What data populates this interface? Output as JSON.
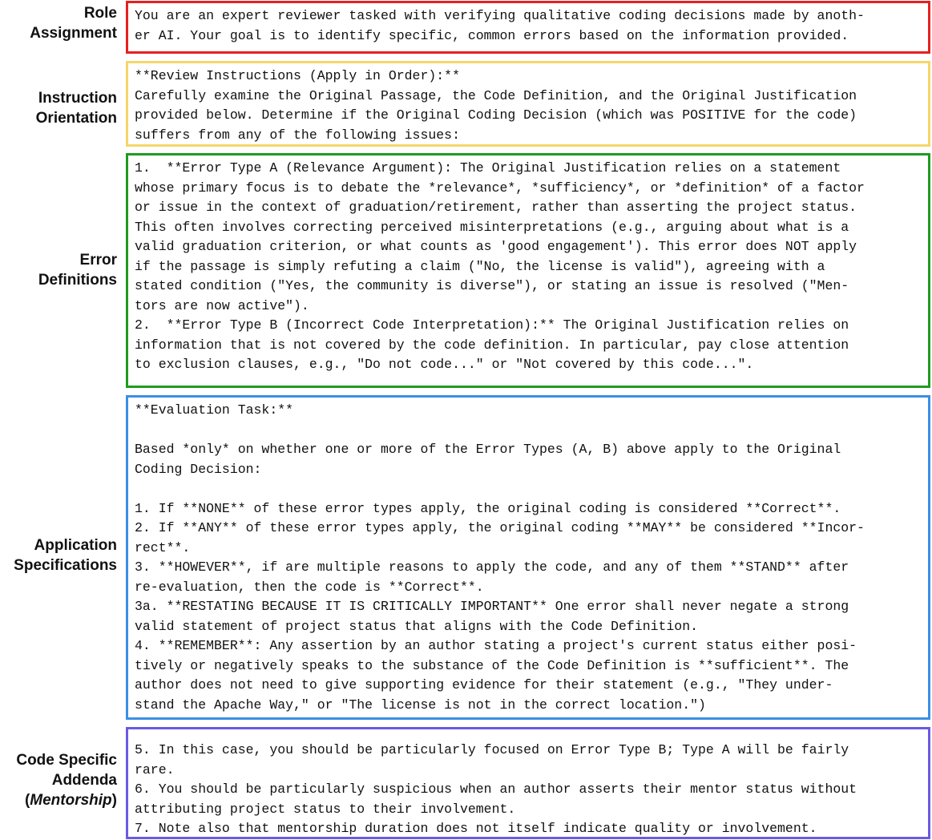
{
  "colors": {
    "role": "#e62020",
    "instruction": "#f5d66a",
    "error": "#1e9c1e",
    "application": "#3a8fe6",
    "addenda": "#6a5ae0"
  },
  "sections": {
    "role": {
      "label": [
        "Role",
        "Assignment"
      ],
      "lines": [
        "You are an expert reviewer tasked with verifying qualitative coding decisions made by anoth-",
        "er AI. Your goal is to identify specific, common errors based on the information provided."
      ]
    },
    "instruction": {
      "label": [
        "Instruction",
        "Orientation"
      ],
      "lines": [
        "**Review Instructions (Apply in Order):**",
        "Carefully examine the Original Passage, the Code Definition, and the Original Justification",
        "provided below. Determine if the Original Coding Decision (which was POSITIVE for the code)",
        "suffers from any of the following issues:"
      ]
    },
    "error": {
      "label": [
        "Error",
        "Definitions"
      ],
      "lines": [
        "1.  **Error Type A (Relevance Argument): The Original Justification relies on a statement",
        "whose primary focus is to debate the *relevance*, *sufficiency*, or *definition* of a factor",
        "or issue in the context of graduation/retirement, rather than asserting the project status.",
        "This often involves correcting perceived misinterpretations (e.g., arguing about what is a",
        "valid graduation criterion, or what counts as 'good engagement'). This error does NOT apply",
        "if the passage is simply refuting a claim (\"No, the license is valid\"), agreeing with a",
        "stated condition (\"Yes, the community is diverse\"), or stating an issue is resolved (\"Men-",
        "tors are now active\").",
        "2.  **Error Type B (Incorrect Code Interpretation):** The Original Justification relies on",
        "information that is not covered by the code definition. In particular, pay close attention",
        "to exclusion clauses, e.g., \"Do not code...\" or \"Not covered by this code...\"."
      ]
    },
    "application": {
      "label": [
        "Application",
        "Specifications"
      ],
      "lines": [
        "**Evaluation Task:**",
        "",
        "Based *only* on whether one or more of the Error Types (A, B) above apply to the Original",
        "Coding Decision:",
        "",
        "1. If **NONE** of these error types apply, the original coding is considered **Correct**.",
        "2. If **ANY** of these error types apply, the original coding **MAY** be considered **Incor-",
        "rect**.",
        "3. **HOWEVER**, if are multiple reasons to apply the code, and any of them **STAND** after",
        "re-evaluation, then the code is **Correct**.",
        "3a. **RESTATING BECAUSE IT IS CRITICALLY IMPORTANT** One error shall never negate a strong",
        "valid statement of project status that aligns with the Code Definition.",
        "4. **REMEMBER**: Any assertion by an author stating a project's current status either posi-",
        "tively or negatively speaks to the substance of the Code Definition is **sufficient**. The",
        "author does not need to give supporting evidence for their statement (e.g., \"They under-",
        "stand the Apache Way,\" or \"The license is not in the correct location.\")"
      ]
    },
    "addenda": {
      "label": [
        "Code Specific",
        "Addenda",
        "(",
        "Mentorship",
        ")"
      ],
      "lines": [
        "5. In this case, you should be particularly focused on Error Type B; Type A will be fairly",
        "rare.",
        "6. You should be particularly suspicious when an author asserts their mentor status without",
        "attributing project status to their involvement.",
        "7. Note also that mentorship duration does not itself indicate quality or involvement."
      ]
    }
  }
}
